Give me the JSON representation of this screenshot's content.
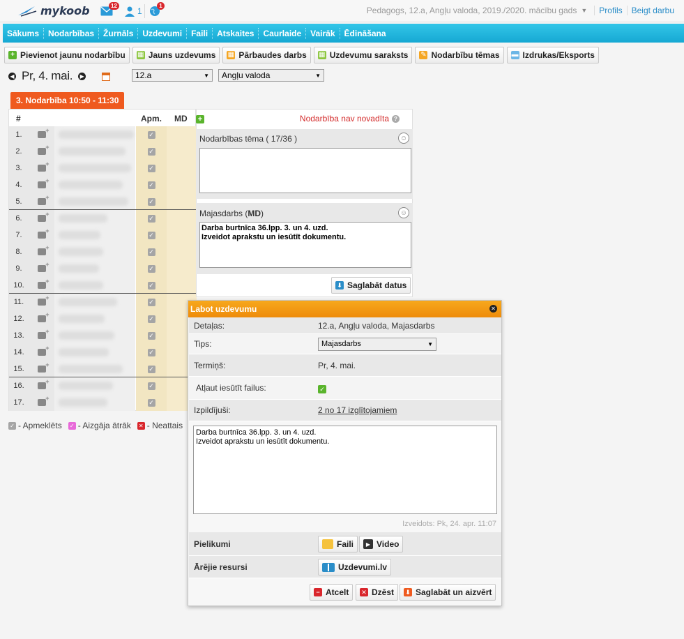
{
  "app": {
    "logo_text": "mykoob",
    "messages_count": "12",
    "users_count": "1",
    "globe_count": "1",
    "context": "Pedagogs, 12.a, Angļu valoda, 2019./2020. mācību gads",
    "profile_link": "Profils",
    "logout_link": "Beigt darbu"
  },
  "nav": {
    "items": [
      "Sākums",
      "Nodarbības",
      "Žurnāls",
      "Uzdevumi",
      "Faili",
      "Atskaites",
      "Caurlaide",
      "Vairāk",
      "Ēdināšana"
    ]
  },
  "toolbar": {
    "add_lesson": "Pievienot jaunu nodarbību",
    "new_task": "Jauns uzdevums",
    "test": "Pārbaudes darbs",
    "task_list": "Uzdevumu saraksts",
    "topics": "Nodarbību tēmas",
    "export": "Izdrukas/Eksports"
  },
  "date_nav": {
    "date": "Pr, 4. mai.",
    "class_select": "12.a",
    "subject_select": "Angļu valoda"
  },
  "lesson": {
    "tab_label": "3. Nodarbība 10:50 - 11:30",
    "status": "Nodarbība nav novadīta"
  },
  "students": {
    "col_num": "#",
    "col_apm": "Apm.",
    "col_md": "MD",
    "rows": [
      "1.",
      "2.",
      "3.",
      "4.",
      "5.",
      "6.",
      "7.",
      "8.",
      "9.",
      "10.",
      "11.",
      "12.",
      "13.",
      "14.",
      "15.",
      "16.",
      "17."
    ]
  },
  "legend": {
    "present": "- Apmeklēts",
    "left_early": "- Aizgāja ātrāk",
    "unexcused": "- Neattais"
  },
  "topic_section": {
    "title": "Nodarbības tēma ( 17/36 )",
    "value": ""
  },
  "homework_section": {
    "title_prefix": "Majasdarbs (",
    "title_bold": "MD",
    "title_suffix": ")",
    "value": "Darba burtnīca 36.lpp. 3. un 4. uzd.\nIzveidot aprakstu un iesūtīt dokumentu."
  },
  "save_button": "Saglabāt datus",
  "modal": {
    "title": "Labot uzdevumu",
    "details_label": "Detaļas:",
    "details_value": "12.a, Angļu valoda, Majasdarbs",
    "type_label": "Tips:",
    "type_value": "Majasdarbs",
    "deadline_label": "Termiņš:",
    "deadline_value": "Pr, 4. mai.",
    "allow_files_label": "Atļaut iesūtīt failus:",
    "done_label": "Izpildījuši:",
    "done_value": "2 no 17 izglītojamiem",
    "text_value": "Darba burtnīca 36.lpp. 3. un 4. uzd.\nIzveidot aprakstu un iesūtīt dokumentu.",
    "created": "Izveidots: Pk, 24. apr. 11:07",
    "attachments_label": "Pielikumi",
    "files_button": "Faili",
    "video_button": "Video",
    "external_label": "Ārējie resursi",
    "external_button": "Uzdevumi.lv",
    "cancel_button": "Atcelt",
    "delete_button": "Dzēst",
    "save_close_button": "Saglabāt un aizvērt"
  },
  "colors": {
    "nav_bg": "#16a8d3",
    "lesson_tab": "#ef5a1f",
    "modal_header": "#f39a14",
    "status_red": "#d32a2a"
  }
}
